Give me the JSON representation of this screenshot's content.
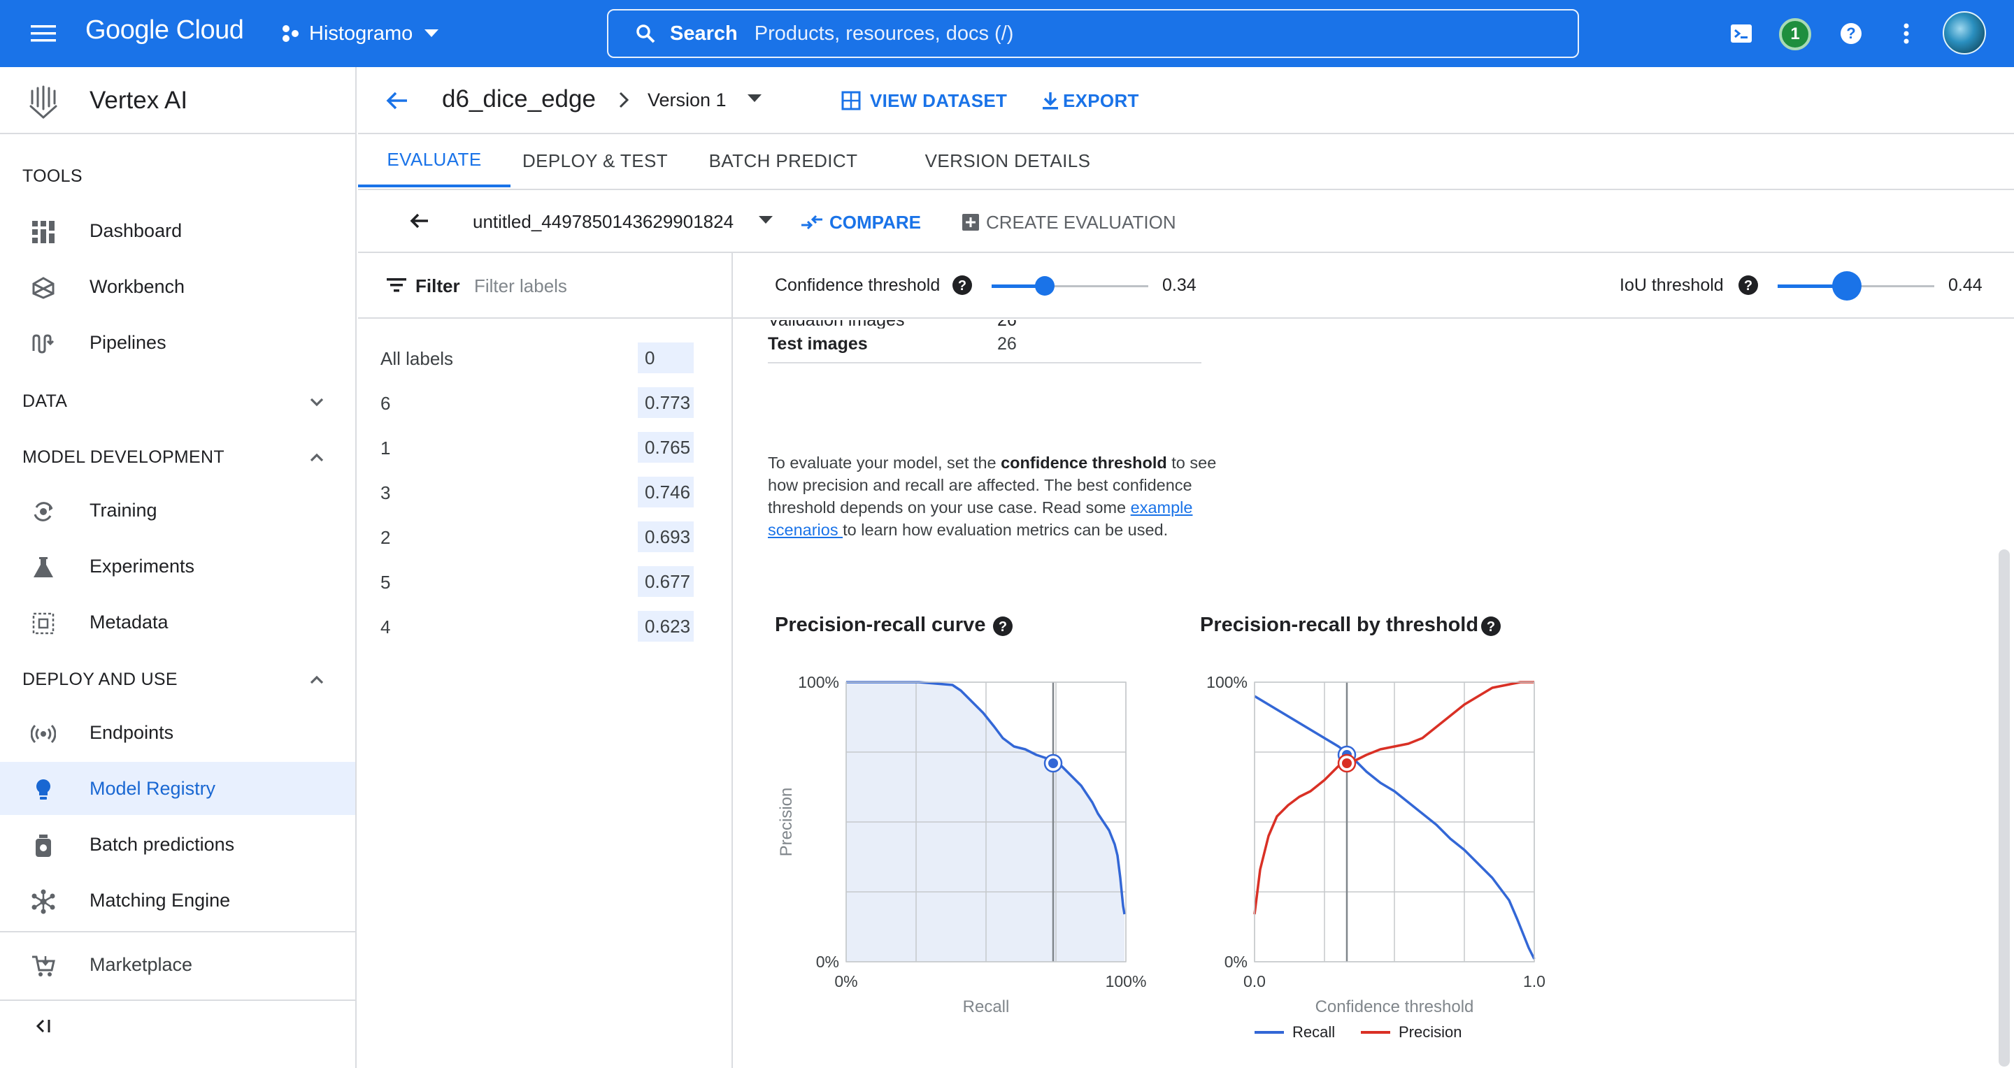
{
  "topbar": {
    "product": "Google Cloud",
    "project": "Histogramo",
    "search_label": "Search",
    "search_placeholder": "Products, resources, docs (/)",
    "notifications": "1"
  },
  "sidebar": {
    "product_name": "Vertex AI",
    "sections": {
      "tools": "TOOLS",
      "data": "DATA",
      "model_development": "MODEL DEVELOPMENT",
      "deploy_and_use": "DEPLOY AND USE"
    },
    "items": {
      "dashboard": "Dashboard",
      "workbench": "Workbench",
      "pipelines": "Pipelines",
      "training": "Training",
      "experiments": "Experiments",
      "metadata": "Metadata",
      "endpoints": "Endpoints",
      "model_registry": "Model Registry",
      "batch_predictions": "Batch predictions",
      "matching_engine": "Matching Engine",
      "marketplace": "Marketplace"
    },
    "active": "model_registry"
  },
  "header": {
    "model_name": "d6_dice_edge",
    "version": "Version 1",
    "view_dataset": "VIEW DATASET",
    "export": "EXPORT"
  },
  "tabs": [
    "EVALUATE",
    "DEPLOY & TEST",
    "BATCH PREDICT",
    "VERSION DETAILS"
  ],
  "active_tab": "EVALUATE",
  "evaluation": {
    "name": "untitled_4497850143629901824",
    "compare": "COMPARE",
    "create": "CREATE EVALUATION"
  },
  "filter": {
    "label": "Filter",
    "placeholder": "Filter labels"
  },
  "labels": [
    {
      "name": "All labels",
      "value": "0"
    },
    {
      "name": "6",
      "value": "0.773"
    },
    {
      "name": "1",
      "value": "0.765"
    },
    {
      "name": "3",
      "value": "0.746"
    },
    {
      "name": "2",
      "value": "0.693"
    },
    {
      "name": "5",
      "value": "0.677"
    },
    {
      "name": "4",
      "value": "0.623"
    }
  ],
  "thresholds": {
    "confidence_label": "Confidence threshold",
    "confidence_value": "0.34",
    "confidence": 0.34,
    "iou_label": "IoU threshold",
    "iou_value": "0.44",
    "iou": 0.44
  },
  "metrics": {
    "cut_row_text": "Validation images",
    "test_images_label": "Test images",
    "test_images_value": "26"
  },
  "description": {
    "p1": "To evaluate your model, set the ",
    "bold": "confidence threshold",
    "p2": " to see how precision and recall are affected. The best confidence threshold depends on your use case. Read some ",
    "link": "example scenarios ",
    "p3": " to learn how evaluation metrics can be used."
  },
  "colors": {
    "accent": "#1a73e8",
    "recall": "#3367d6",
    "precision": "#d93025",
    "area": "#e8eef9"
  },
  "chart_data": [
    {
      "type": "line",
      "title": "Precision-recall curve",
      "xlabel": "Recall",
      "ylabel": "Precision",
      "x_ticks": [
        "0%",
        "100%"
      ],
      "y_ticks": [
        "0%",
        "100%"
      ],
      "xlim": [
        0,
        1
      ],
      "ylim": [
        0,
        1
      ],
      "grid": true,
      "fill_area": true,
      "series": [
        {
          "x": [
            0.0,
            0.1,
            0.2,
            0.26,
            0.38,
            0.41,
            0.45,
            0.49,
            0.53,
            0.56,
            0.6,
            0.64,
            0.68,
            0.71,
            0.74,
            0.77,
            0.8,
            0.84,
            0.88,
            0.9,
            0.92,
            0.94,
            0.96,
            0.97,
            0.98,
            0.99,
            0.995
          ],
          "y": [
            1.0,
            1.0,
            1.0,
            1.0,
            0.99,
            0.97,
            0.93,
            0.89,
            0.84,
            0.8,
            0.77,
            0.76,
            0.74,
            0.73,
            0.72,
            0.7,
            0.67,
            0.63,
            0.57,
            0.53,
            0.5,
            0.47,
            0.42,
            0.38,
            0.3,
            0.2,
            0.17
          ]
        }
      ],
      "marker": {
        "x": 0.74,
        "y": 0.71
      },
      "vline_x": 0.74
    },
    {
      "type": "line",
      "title": "Precision-recall by threshold",
      "xlabel": "Confidence threshold",
      "x_ticks": [
        "0.0",
        "1.0"
      ],
      "y_ticks": [
        "0%",
        "100%"
      ],
      "xlim": [
        0,
        1
      ],
      "ylim": [
        0,
        1
      ],
      "grid": true,
      "legend": "bottom",
      "series": [
        {
          "name": "Recall",
          "x": [
            0.0,
            0.05,
            0.1,
            0.15,
            0.2,
            0.25,
            0.3,
            0.34,
            0.4,
            0.45,
            0.5,
            0.55,
            0.6,
            0.65,
            0.7,
            0.75,
            0.8,
            0.85,
            0.88,
            0.91,
            0.94,
            0.96,
            0.98,
            1.0
          ],
          "y": [
            0.95,
            0.92,
            0.89,
            0.86,
            0.83,
            0.8,
            0.77,
            0.74,
            0.68,
            0.64,
            0.61,
            0.57,
            0.53,
            0.49,
            0.44,
            0.4,
            0.35,
            0.3,
            0.26,
            0.22,
            0.15,
            0.1,
            0.05,
            0.01
          ]
        },
        {
          "name": "Precision",
          "x": [
            0.0,
            0.02,
            0.05,
            0.08,
            0.12,
            0.16,
            0.2,
            0.25,
            0.3,
            0.34,
            0.4,
            0.45,
            0.5,
            0.55,
            0.6,
            0.65,
            0.7,
            0.75,
            0.8,
            0.85,
            0.9,
            0.95,
            1.0
          ],
          "y": [
            0.17,
            0.33,
            0.45,
            0.52,
            0.56,
            0.59,
            0.61,
            0.65,
            0.7,
            0.71,
            0.74,
            0.76,
            0.77,
            0.78,
            0.8,
            0.84,
            0.88,
            0.92,
            0.95,
            0.98,
            0.99,
            1.0,
            1.0
          ]
        }
      ],
      "vline_x": 0.33,
      "markers": [
        {
          "series": "Recall",
          "x": 0.33,
          "y": 0.74
        },
        {
          "series": "Precision",
          "x": 0.33,
          "y": 0.71
        }
      ]
    }
  ]
}
